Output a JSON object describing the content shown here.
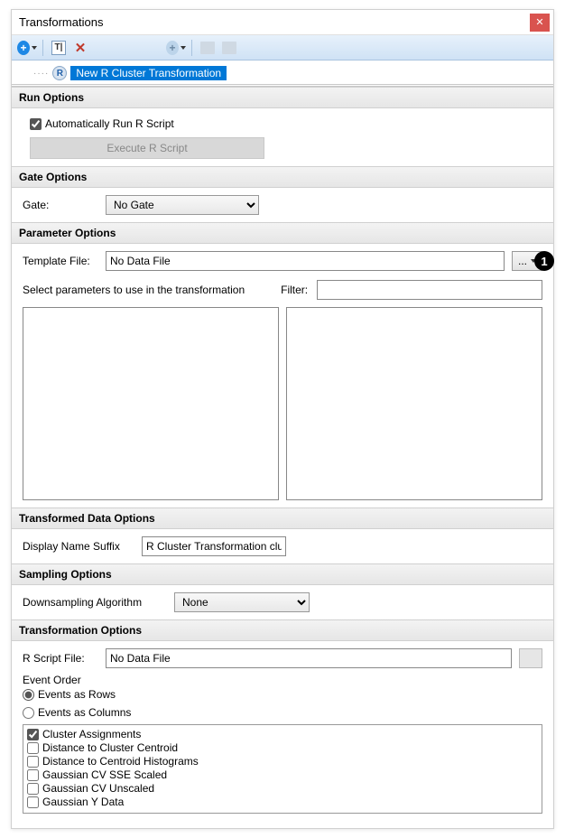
{
  "window": {
    "title": "Transformations"
  },
  "tree": {
    "selected_label": "New R Cluster Transformation"
  },
  "run_options": {
    "header": "Run Options",
    "auto_run_label": "Automatically Run R Script",
    "auto_run_checked": true,
    "execute_button": "Execute R Script"
  },
  "gate_options": {
    "header": "Gate Options",
    "gate_label": "Gate:",
    "gate_value": "No Gate"
  },
  "parameter_options": {
    "header": "Parameter Options",
    "template_label": "Template File:",
    "template_value": "No Data File",
    "browse_label": "...",
    "select_params_label": "Select parameters to use in the transformation",
    "filter_label": "Filter:",
    "filter_value": ""
  },
  "transformed_data_options": {
    "header": "Transformed Data Options",
    "suffix_label": "Display Name Suffix",
    "suffix_value": "R Cluster Transformation clu"
  },
  "sampling_options": {
    "header": "Sampling Options",
    "downsampling_label": "Downsampling Algorithm",
    "downsampling_value": "None"
  },
  "transformation_options": {
    "header": "Transformation Options",
    "rscript_label": "R Script File:",
    "rscript_value": "No Data File",
    "event_order_label": "Event Order",
    "events_rows_label": "Events as Rows",
    "events_cols_label": "Events as Columns",
    "event_order_selected": "rows",
    "output_options": [
      {
        "label": "Cluster Assignments",
        "checked": true
      },
      {
        "label": "Distance to Cluster Centroid",
        "checked": false
      },
      {
        "label": "Distance to Centroid Histograms",
        "checked": false
      },
      {
        "label": "Gaussian CV SSE Scaled",
        "checked": false
      },
      {
        "label": "Gaussian CV Unscaled",
        "checked": false
      },
      {
        "label": "Gaussian Y Data",
        "checked": false
      }
    ]
  },
  "annotation": {
    "label": "1"
  }
}
